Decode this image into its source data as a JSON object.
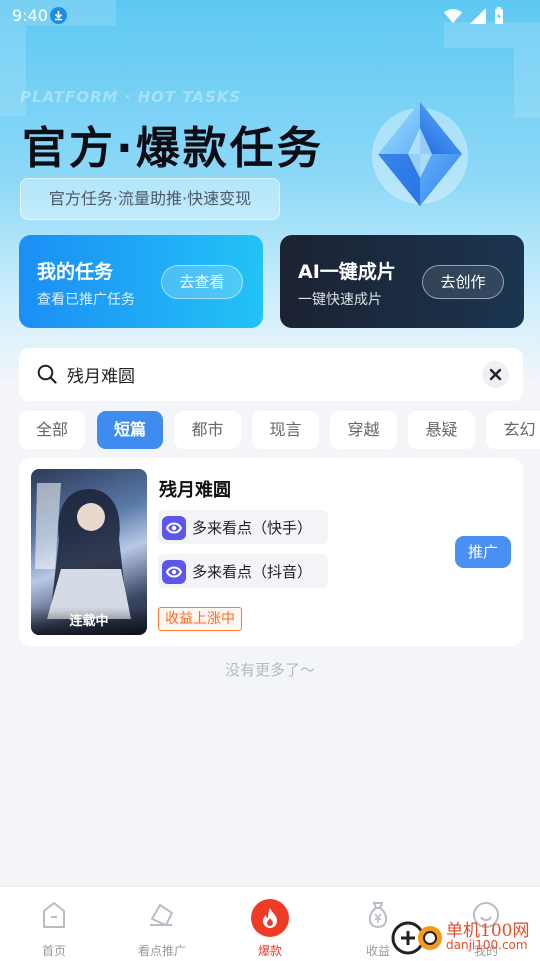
{
  "status_bar": {
    "time": "9:40"
  },
  "hero": {
    "eng_title": "PLATFORM · HOT TASKS",
    "title": "官方·爆款任务",
    "subtitle": "官方任务·流量助推·快速变现"
  },
  "cards": [
    {
      "title": "我的任务",
      "sub": "查看已推广任务",
      "button": "去查看"
    },
    {
      "title": "AI一键成片",
      "sub": "一键快速成片",
      "button": "去创作"
    }
  ],
  "search": {
    "value": "残月难圆"
  },
  "tabs": [
    "全部",
    "短篇",
    "都市",
    "现言",
    "穿越",
    "悬疑",
    "玄幻"
  ],
  "active_tab": "短篇",
  "item": {
    "title": "残月难圆",
    "cover_status": "连载中",
    "platforms": [
      "多来看点（快手）",
      "多来看点（抖音）"
    ],
    "button": "推广",
    "badge": "收益上涨中"
  },
  "list_end": "没有更多了〜",
  "nav": [
    {
      "label": "首页",
      "icon": "home-icon"
    },
    {
      "label": "看点推广",
      "icon": "promote-icon"
    },
    {
      "label": "爆款",
      "icon": "fire-icon"
    },
    {
      "label": "收益",
      "icon": "money-bag-icon"
    },
    {
      "label": "我的",
      "icon": "profile-icon"
    }
  ],
  "watermark": {
    "title": "单机100网",
    "sub": "danji100.com"
  },
  "colors": {
    "accent": "#3e8cf0",
    "fire": "#ef3b26",
    "badge": "#ff6a25"
  }
}
